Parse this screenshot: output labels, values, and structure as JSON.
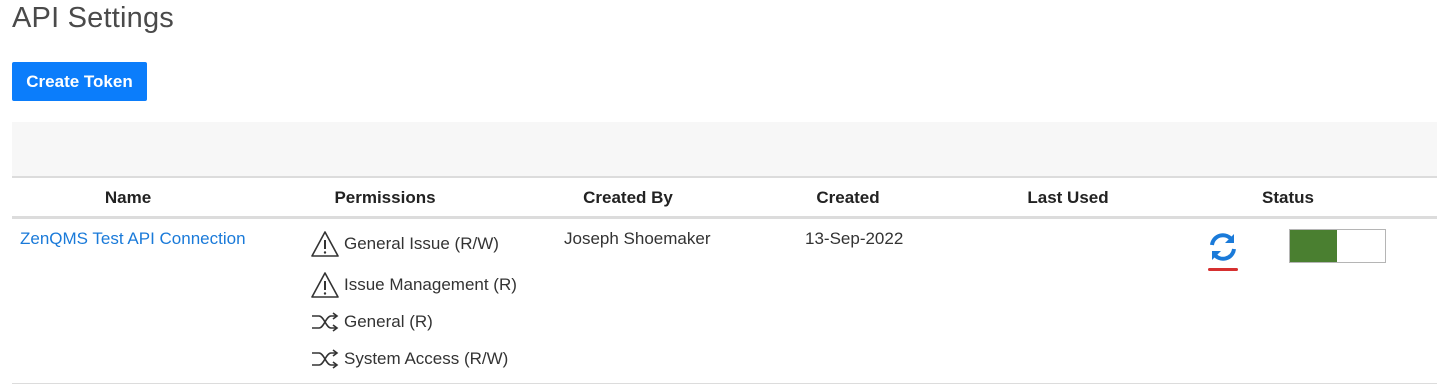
{
  "page": {
    "title": "API Settings"
  },
  "toolbar": {
    "create_label": "Create Token"
  },
  "table": {
    "columns": [
      "Name",
      "Permissions",
      "Created By",
      "Created",
      "Last Used",
      "Status"
    ],
    "rows": [
      {
        "name": "ZenQMS Test API Connection",
        "permissions": [
          {
            "label": "General Issue (R/W)",
            "icon": "warning-triangle-icon"
          },
          {
            "label": "Issue Management (R)",
            "icon": "warning-triangle-icon"
          },
          {
            "label": "General (R)",
            "icon": "shuffle-icon"
          },
          {
            "label": "System Access (R/W)",
            "icon": "shuffle-icon"
          }
        ],
        "created_by": "Joseph Shoemaker",
        "created": "13-Sep-2022",
        "last_used": "",
        "status_enabled": true
      }
    ]
  },
  "colors": {
    "primary": "#0b7dfb",
    "link": "#1a7ad9",
    "toggle_on": "#4a7f30",
    "refresh_icon": "#1a7ad9",
    "refresh_underline": "#d63030"
  }
}
